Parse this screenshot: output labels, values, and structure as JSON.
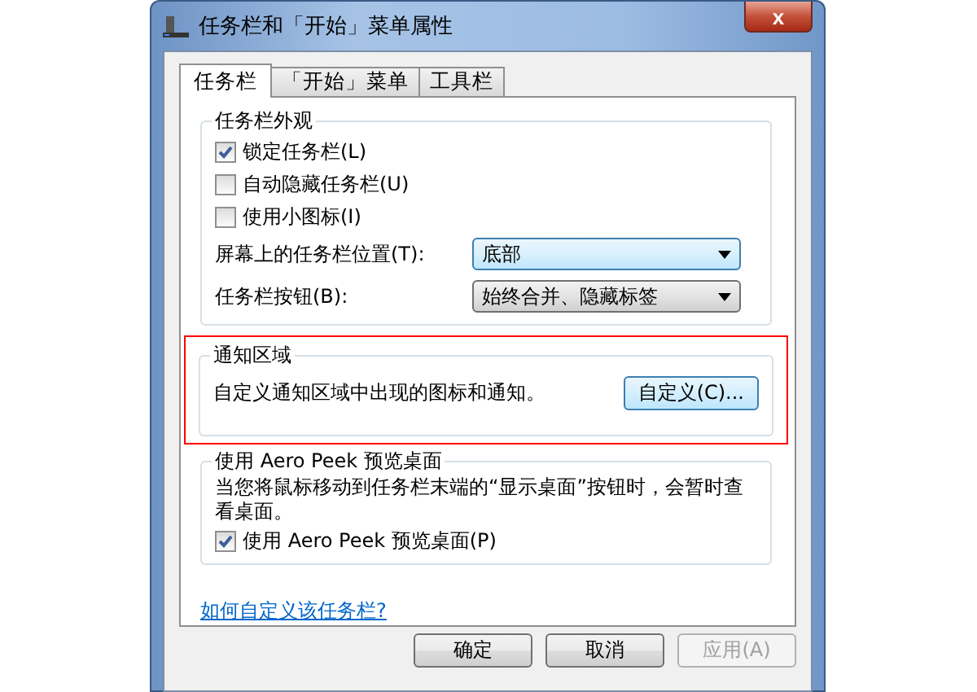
{
  "window": {
    "title": "任务栏和「开始」菜单属性",
    "close": "x"
  },
  "tabs": [
    {
      "label": "任务栏",
      "selected": true
    },
    {
      "label": "「开始」菜单",
      "selected": false
    },
    {
      "label": "工具栏",
      "selected": false
    }
  ],
  "appearance": {
    "title": "任务栏外观",
    "checkboxes": [
      {
        "label": "锁定任务栏(L)",
        "checked": true
      },
      {
        "label": "自动隐藏任务栏(U)",
        "checked": false
      },
      {
        "label": "使用小图标(I)",
        "checked": false
      }
    ],
    "dropdowns": [
      {
        "label": "屏幕上的任务栏位置(T):",
        "value": "底部",
        "hovered": true
      },
      {
        "label": "任务栏按钮(B):",
        "value": "始终合并、隐藏标签",
        "hovered": false
      }
    ]
  },
  "notification": {
    "title": "通知区域",
    "text": "自定义通知区域中出现的图标和通知。",
    "button": "自定义(C)...",
    "highlighted": true
  },
  "aero_peek": {
    "title": "使用 Aero Peek 预览桌面",
    "text": "当您将鼠标移动到任务栏末端的“显示桌面”按钮时，会暂时查看桌面。",
    "checkbox": {
      "label": "使用 Aero Peek 预览桌面(P)",
      "checked": true
    }
  },
  "help_link": "如何自定义该任务栏?",
  "buttons": [
    {
      "label": "确定",
      "disabled": false
    },
    {
      "label": "取消",
      "disabled": false
    },
    {
      "label": "应用(A)",
      "disabled": true
    }
  ]
}
